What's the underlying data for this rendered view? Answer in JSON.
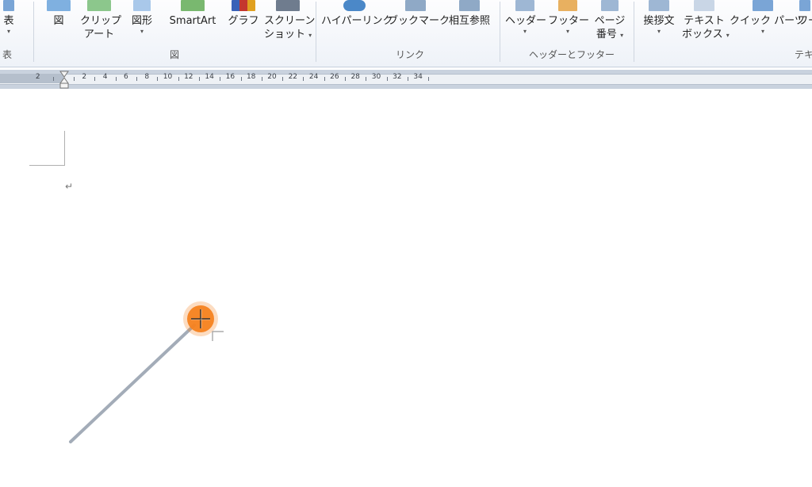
{
  "ribbon": {
    "table_group": {
      "button_label": "表",
      "group_label": "表"
    },
    "illustrations": {
      "group_label": "図",
      "picture": "図",
      "clipart_1": "クリップ",
      "clipart_2": "アート",
      "shapes": "図形",
      "smartart": "SmartArt",
      "chart": "グラフ",
      "screenshot_1": "スクリーン",
      "screenshot_2": "ショット"
    },
    "links": {
      "group_label": "リンク",
      "hyperlink": "ハイパーリンク",
      "bookmark": "ブックマーク",
      "cross_reference": "相互参照"
    },
    "header_footer": {
      "group_label": "ヘッダーとフッター",
      "header": "ヘッダー",
      "footer": "フッター",
      "page_number_1": "ページ",
      "page_number_2": "番号"
    },
    "text": {
      "group_label": "テキ",
      "greeting_1": "挨拶文",
      "textbox_1": "テキスト",
      "textbox_2": "ボックス",
      "quickparts": "クイック パーツ",
      "wordart": "ワー"
    },
    "dropdown_glyph": "▾"
  },
  "ruler": {
    "labels": [
      "2",
      "2",
      "4",
      "6",
      "8",
      "10",
      "12",
      "14",
      "16",
      "18",
      "20",
      "22",
      "24",
      "26",
      "28",
      "30",
      "32",
      "34"
    ]
  },
  "document": {
    "paragraph_mark": "↵"
  },
  "colors": {
    "accent": "#f58220",
    "line": "#a3acb8"
  }
}
